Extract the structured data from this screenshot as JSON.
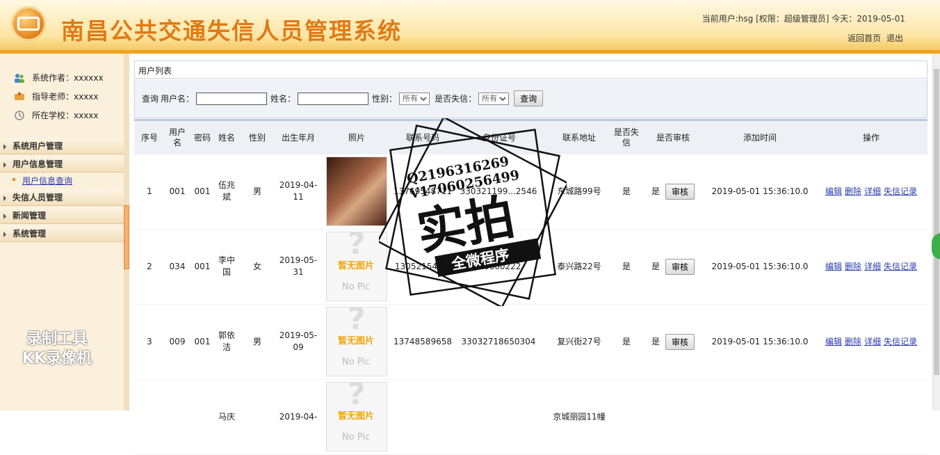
{
  "header": {
    "title": "南昌公共交通失信人员管理系统",
    "user_info": "当前用户:hsg [权限：超级管理员] 今天：2019-05-01",
    "home_link": "返回首页",
    "logout_link": "退出"
  },
  "sidebar": {
    "info": [
      {
        "label": "系统作者：xxxxxx",
        "icon": "users-icon"
      },
      {
        "label": "指导老师：xxxxx",
        "icon": "teacher-icon"
      },
      {
        "label": "所在学校：xxxxx",
        "icon": "school-icon"
      }
    ],
    "menus": [
      "系统用户管理",
      "用户信息管理",
      "失信人员管理",
      "新闻管理",
      "系统管理"
    ],
    "submenu": "用户信息查询"
  },
  "panel_title": "用户列表",
  "search": {
    "query_label": "查询",
    "username_label": "用户名：",
    "name_label": "姓名：",
    "gender_label": "性别：",
    "gender_value": "所有",
    "dishonest_label": "是否失信：",
    "dishonest_value": "所有",
    "search_button": "查询"
  },
  "table": {
    "headers": [
      "序号",
      "用户名",
      "密码",
      "姓名",
      "性别",
      "出生年月",
      "照片",
      "联系号码",
      "身份证号",
      "联系地址",
      "是否失信",
      "是否审核",
      "添加时间",
      "操作"
    ],
    "rows": [
      {
        "no": "1",
        "username": "001",
        "password": "001",
        "name": "伍兆斌",
        "gender": "男",
        "birth": "2019-04-11",
        "photo": "real",
        "phone": "13769548711",
        "idcard": "330321199...2546",
        "address": "东城路99号",
        "dishonest": "是",
        "audited": "是",
        "added": "2019-05-01 15:36:10.0"
      },
      {
        "no": "2",
        "username": "034",
        "password": "001",
        "name": "李中国",
        "gender": "女",
        "birth": "2019-05-31",
        "photo": "none",
        "phone": "130521548...",
        "idcard": "...0060222",
        "address": "泰兴路22号",
        "dishonest": "是",
        "audited": "是",
        "added": "2019-05-01 15:36:10.0"
      },
      {
        "no": "3",
        "username": "009",
        "password": "001",
        "name": "郭依洁",
        "gender": "男",
        "birth": "2019-05-09",
        "photo": "none",
        "phone": "13748589658",
        "idcard": "33032718650304",
        "address": "复兴街27号",
        "dishonest": "是",
        "audited": "是",
        "added": "2019-05-01 15:36:10.0"
      },
      {
        "no": "",
        "username": "",
        "password": "",
        "name": "马庆",
        "gender": "",
        "birth": "2019-04-",
        "photo": "none",
        "phone": "",
        "idcard": "",
        "address": "京城丽园11幢",
        "dishonest": "",
        "audited": "",
        "added": ""
      }
    ],
    "audit_button": "审核",
    "ops": [
      "编辑",
      "删除",
      "详细",
      "失信记录"
    ],
    "no_pic_zh": "暂无图片",
    "no_pic_en": "No Pic"
  },
  "watermarks": {
    "recorder_line1": "录制工具",
    "recorder_line2": "KK录像机",
    "stamp_qq": "Q2196316269",
    "stamp_v": "V17060256499",
    "stamp_main": "实拍",
    "stamp_banner": "全微程序"
  }
}
